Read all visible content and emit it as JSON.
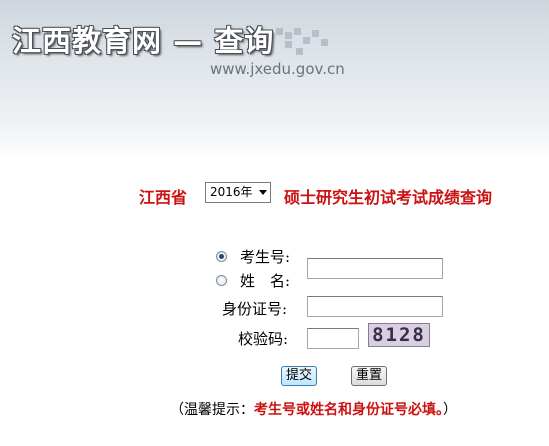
{
  "header": {
    "site_title": "江西教育网 — 查询",
    "site_url": "www.jxedu.gov.cn"
  },
  "query": {
    "province": "江西省",
    "year_selected": "2016年",
    "title": "硕士研究生初试考试成绩查询"
  },
  "form": {
    "exam_no_label": "考生号:",
    "name_label": "姓　名:",
    "id_label": "身份证号:",
    "captcha_label": "校验码:",
    "captcha_text": "8128",
    "exam_no_value": "",
    "name_value": "",
    "id_value": "",
    "captcha_value": "",
    "selected_mode": "exam_no"
  },
  "buttons": {
    "submit": "提交",
    "reset": "重置"
  },
  "tip": {
    "prefix": "（温馨提示：",
    "emphasis": "考生号或姓名和身份证号必填。",
    "suffix": "）"
  }
}
